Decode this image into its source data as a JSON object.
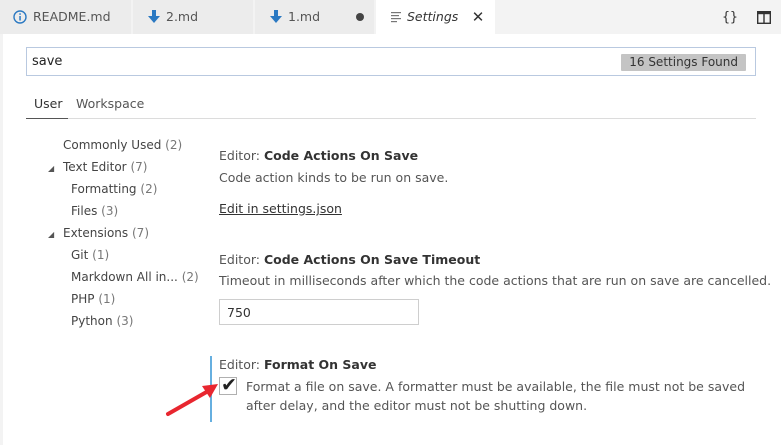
{
  "tabs": [
    {
      "label": "README.md",
      "icon": "info-icon"
    },
    {
      "label": "2.md",
      "icon": "download-arrow-icon"
    },
    {
      "label": "1.md",
      "icon": "download-arrow-icon",
      "dirty": true
    },
    {
      "label": "Settings",
      "icon": "lines-icon",
      "active": true,
      "close": "✕"
    }
  ],
  "editor_actions": {
    "json": "{}",
    "split": "split-editor-icon"
  },
  "search": {
    "value": "save",
    "count": "16 Settings Found"
  },
  "scopes": {
    "user": "User",
    "workspace": "Workspace"
  },
  "toc": [
    {
      "label": "Commonly Used",
      "count": "(2)"
    },
    {
      "label": "Text Editor",
      "count": "(7)",
      "expanded": true
    },
    {
      "label": "Formatting",
      "count": "(2)"
    },
    {
      "label": "Files",
      "count": "(3)"
    },
    {
      "label": "Extensions",
      "count": "(7)",
      "expanded": true
    },
    {
      "label": "Git",
      "count": "(1)"
    },
    {
      "label": "Markdown All in...",
      "count": "(2)"
    },
    {
      "label": "PHP",
      "count": "(1)"
    },
    {
      "label": "Python",
      "count": "(3)"
    }
  ],
  "settings": {
    "code_actions": {
      "category": "Editor: ",
      "name": "Code Actions On Save",
      "description": "Code action kinds to be run on save.",
      "link": "Edit in settings.json"
    },
    "code_actions_timeout": {
      "category": "Editor: ",
      "name": "Code Actions On Save Timeout",
      "description": "Timeout in milliseconds after which the code actions that are run on save are cancelled.",
      "value": "750"
    },
    "format_on_save": {
      "category": "Editor: ",
      "name": "Format On Save",
      "description": "Format a file on save. A formatter must be available, the file must not be saved after delay, and the editor must not be shutting down.",
      "checked": true
    }
  },
  "colors": {
    "accent": "#66afe0",
    "arrow": "#e8262f"
  }
}
